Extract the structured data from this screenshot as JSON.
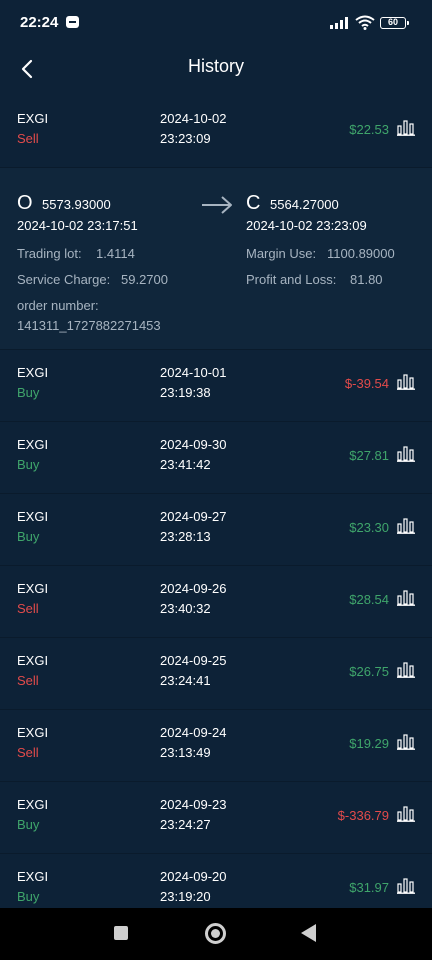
{
  "status_bar": {
    "time": "22:24",
    "battery": "60"
  },
  "header": {
    "title": "History"
  },
  "first_trade": {
    "symbol": "EXGI",
    "side": "Sell",
    "side_type": "sell",
    "date": "2024-10-02",
    "time": "23:23:09",
    "pnl": "$22.53",
    "pnl_type": "pos"
  },
  "detail": {
    "open_marker": "O",
    "open_price": "5573.93000",
    "open_time": "2024-10-02 23:17:51",
    "close_marker": "C",
    "close_price": "5564.27000",
    "close_time": "2024-10-02 23:23:09",
    "trading_lot_label": "Trading lot:",
    "trading_lot": "1.4114",
    "service_charge_label": "Service Charge:",
    "service_charge": "59.2700",
    "margin_use_label": "Margin Use:",
    "margin_use": "1100.89000",
    "pnl_label": "Profit and Loss:",
    "pnl": "81.80",
    "order_number_label": "order number:",
    "order_number": "141311_1727882271453"
  },
  "trades": [
    {
      "symbol": "EXGI",
      "side": "Buy",
      "side_type": "buy",
      "date": "2024-10-01",
      "time": "23:19:38",
      "pnl": "$-39.54",
      "pnl_type": "neg"
    },
    {
      "symbol": "EXGI",
      "side": "Buy",
      "side_type": "buy",
      "date": "2024-09-30",
      "time": "23:41:42",
      "pnl": "$27.81",
      "pnl_type": "pos"
    },
    {
      "symbol": "EXGI",
      "side": "Buy",
      "side_type": "buy",
      "date": "2024-09-27",
      "time": "23:28:13",
      "pnl": "$23.30",
      "pnl_type": "pos"
    },
    {
      "symbol": "EXGI",
      "side": "Sell",
      "side_type": "sell",
      "date": "2024-09-26",
      "time": "23:40:32",
      "pnl": "$28.54",
      "pnl_type": "pos"
    },
    {
      "symbol": "EXGI",
      "side": "Sell",
      "side_type": "sell",
      "date": "2024-09-25",
      "time": "23:24:41",
      "pnl": "$26.75",
      "pnl_type": "pos"
    },
    {
      "symbol": "EXGI",
      "side": "Sell",
      "side_type": "sell",
      "date": "2024-09-24",
      "time": "23:13:49",
      "pnl": "$19.29",
      "pnl_type": "pos"
    },
    {
      "symbol": "EXGI",
      "side": "Buy",
      "side_type": "buy",
      "date": "2024-09-23",
      "time": "23:24:27",
      "pnl": "$-336.79",
      "pnl_type": "neg"
    },
    {
      "symbol": "EXGI",
      "side": "Buy",
      "side_type": "buy",
      "date": "2024-09-20",
      "time": "23:19:20",
      "pnl": "$31.97",
      "pnl_type": "pos"
    }
  ],
  "colors": {
    "background": "#0d2237",
    "detail_background": "#10263b",
    "positive": "#3fa56b",
    "negative": "#e24b4b",
    "muted_label": "#a7b4c1"
  },
  "icons": {
    "back": "chevron-left-icon",
    "chart": "bar-chart-icon",
    "arrow": "arrow-right-icon"
  }
}
